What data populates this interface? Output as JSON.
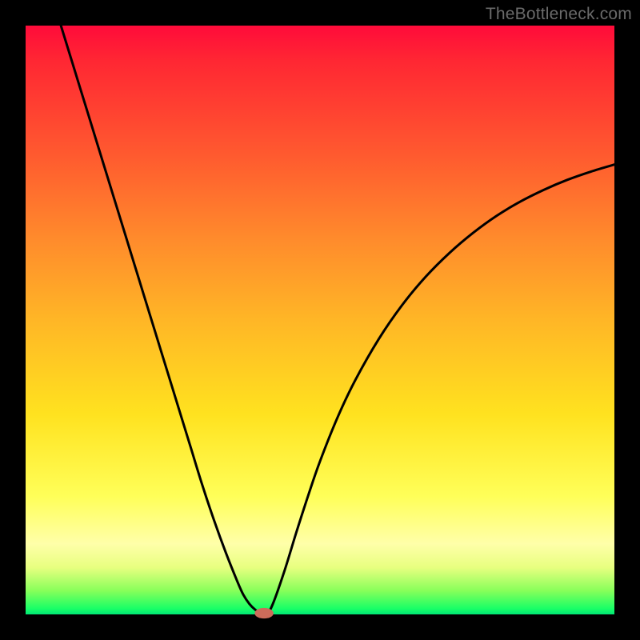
{
  "watermark": "TheBottleneck.com",
  "colors": {
    "curve_stroke": "#000000",
    "marker_fill": "#cc6b5a"
  },
  "chart_data": {
    "type": "line",
    "title": "",
    "xlabel": "",
    "ylabel": "",
    "xlim": [
      0,
      100
    ],
    "ylim": [
      0,
      100
    ],
    "grid": false,
    "legend": false,
    "series": [
      {
        "name": "bottleneck-curve",
        "x": [
          6,
          8,
          10,
          12,
          14,
          16,
          18,
          20,
          22,
          24,
          26,
          28,
          30,
          32,
          34,
          36,
          37,
          38,
          39,
          40,
          41,
          42,
          44,
          46,
          48,
          50,
          53,
          56,
          60,
          64,
          68,
          72,
          76,
          80,
          84,
          88,
          92,
          96,
          100
        ],
        "y": [
          100,
          93.5,
          87,
          80.5,
          74,
          67.5,
          61,
          54.5,
          48,
          41.5,
          35,
          28.5,
          22,
          16,
          10.5,
          5.5,
          3.3,
          1.8,
          0.8,
          0.2,
          0.2,
          1.8,
          7.5,
          14,
          20.2,
          26,
          33.5,
          39.8,
          46.8,
          52.6,
          57.4,
          61.4,
          64.8,
          67.7,
          70.1,
          72.1,
          73.8,
          75.2,
          76.4
        ]
      }
    ],
    "marker": {
      "x": 40.5,
      "y": 0.2,
      "rx": 1.6,
      "ry": 0.9
    }
  }
}
